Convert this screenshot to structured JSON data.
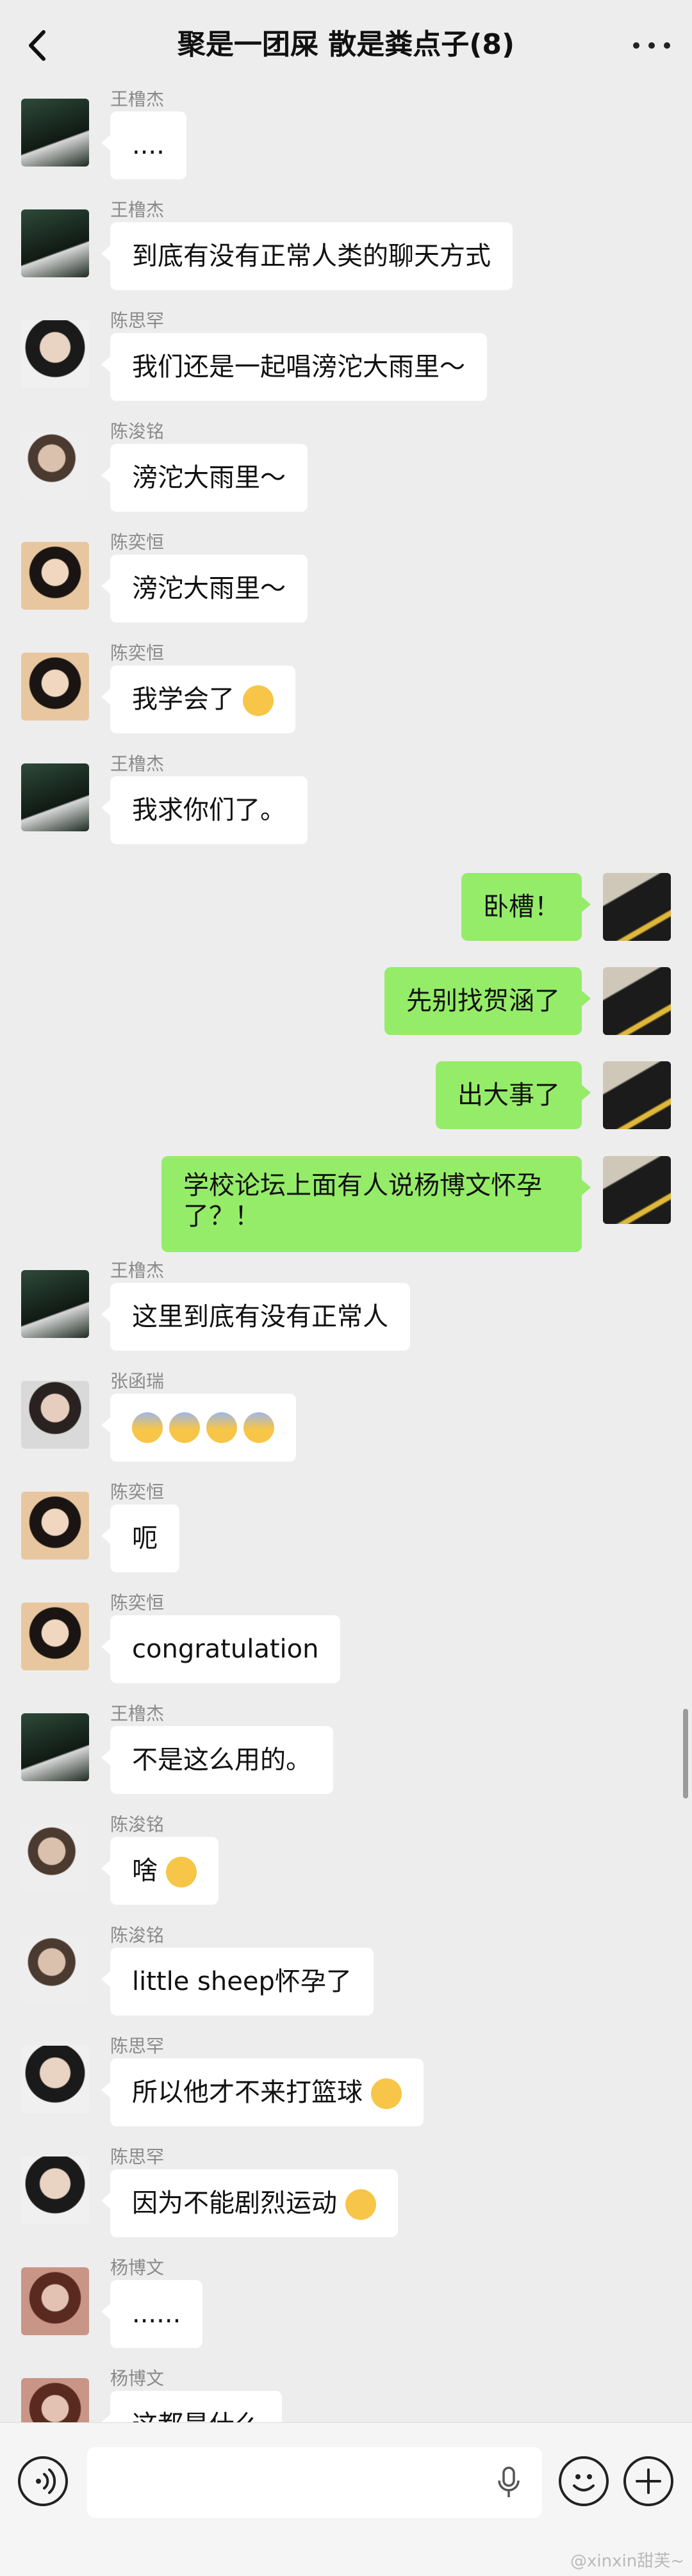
{
  "app": {
    "title": "聚是一团屎 散是粪点子(8)"
  },
  "colors": {
    "background": "#ededed",
    "incoming_bubble": "#ffffff",
    "outgoing_bubble": "#95ec69",
    "name_text": "#8a8a8a"
  },
  "icons": {
    "back": "chevron-left-icon",
    "more": "more-horizontal-icon",
    "voice": "voice-icon",
    "mic": "mic-icon",
    "emoji": "emoji-icon",
    "plus": "plus-icon"
  },
  "messages": [
    {
      "side": "left",
      "sender": "王橹杰",
      "text": "....",
      "avatar": "dark-outdoor"
    },
    {
      "side": "left",
      "sender": "王橹杰",
      "text": "到底有没有正常人类的聊天方式",
      "avatar": "dark-outdoor"
    },
    {
      "side": "left",
      "sender": "陈思罕",
      "text": "我们还是一起唱滂沱大雨里～",
      "avatar": "glasses"
    },
    {
      "side": "left",
      "sender": "陈浚铭",
      "text": "滂沱大雨里～",
      "avatar": "light"
    },
    {
      "side": "left",
      "sender": "陈奕恒",
      "text": "滂沱大雨里～",
      "avatar": "warm"
    },
    {
      "side": "left",
      "sender": "陈奕恒",
      "text": "我学会了",
      "emoji": [
        "grin-emoji"
      ],
      "avatar": "warm"
    },
    {
      "side": "left",
      "sender": "王橹杰",
      "text": "我求你们了。",
      "avatar": "dark-outdoor"
    },
    {
      "side": "right",
      "text": "卧槽！",
      "avatar": "self"
    },
    {
      "side": "right",
      "text": "先别找贺涵了",
      "avatar": "self"
    },
    {
      "side": "right",
      "text": "出大事了",
      "avatar": "self"
    },
    {
      "side": "right",
      "text": "学校论坛上面有人说杨博文怀孕了？！",
      "avatar": "self"
    },
    {
      "side": "left",
      "sender": "王橹杰",
      "text": "这里到底有没有正常人",
      "avatar": "dark-outdoor"
    },
    {
      "side": "left",
      "sender": "张函瑞",
      "text": "",
      "emoji": [
        "scream-emoji",
        "scream-emoji",
        "scream-emoji",
        "scream-emoji"
      ],
      "avatar": "boy"
    },
    {
      "side": "left",
      "sender": "陈奕恒",
      "text": "呃",
      "avatar": "warm"
    },
    {
      "side": "left",
      "sender": "陈奕恒",
      "text": "congratulation",
      "avatar": "warm"
    },
    {
      "side": "left",
      "sender": "王橹杰",
      "text": "不是这么用的。",
      "avatar": "dark-outdoor"
    },
    {
      "side": "left",
      "sender": "陈浚铭",
      "text": "啥",
      "emoji": [
        "surprised-emoji"
      ],
      "avatar": "light"
    },
    {
      "side": "left",
      "sender": "陈浚铭",
      "text": "little sheep怀孕了",
      "avatar": "light"
    },
    {
      "side": "left",
      "sender": "陈思罕",
      "text": "所以他才不来打篮球",
      "emoji": [
        "surprised-emoji"
      ],
      "avatar": "glasses"
    },
    {
      "side": "left",
      "sender": "陈思罕",
      "text": "因为不能剧烈运动",
      "emoji": [
        "surprised-emoji"
      ],
      "avatar": "glasses"
    },
    {
      "side": "left",
      "sender": "杨博文",
      "text": "......",
      "avatar": "red"
    },
    {
      "side": "left",
      "sender": "杨博文",
      "text": "这都是什么",
      "avatar": "red"
    }
  ],
  "input": {
    "placeholder": ""
  },
  "watermark": "@xinxin甜芙~"
}
